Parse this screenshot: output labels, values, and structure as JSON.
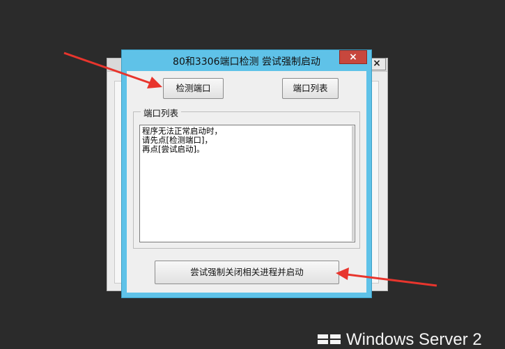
{
  "dialog": {
    "title": "80和3306端口检测 尝试强制启动",
    "close_glyph": "×",
    "detect_button": "检测端口",
    "list_button": "端口列表",
    "group_label": "端口列表",
    "text_lines": [
      "程序无法正常启动时，",
      "请先点[检测端口]，",
      "再点[尝试启动]。"
    ],
    "force_button": "尝试强制关闭相关进程并启动"
  },
  "background_window": {
    "close_glyph": "×"
  },
  "watermark": {
    "text": "Windows Server 2"
  },
  "colors": {
    "desktop": "#2b2b2b",
    "dialog_frame": "#5fc2e8",
    "close_button": "#c7473d",
    "arrow": "#e8352d"
  }
}
